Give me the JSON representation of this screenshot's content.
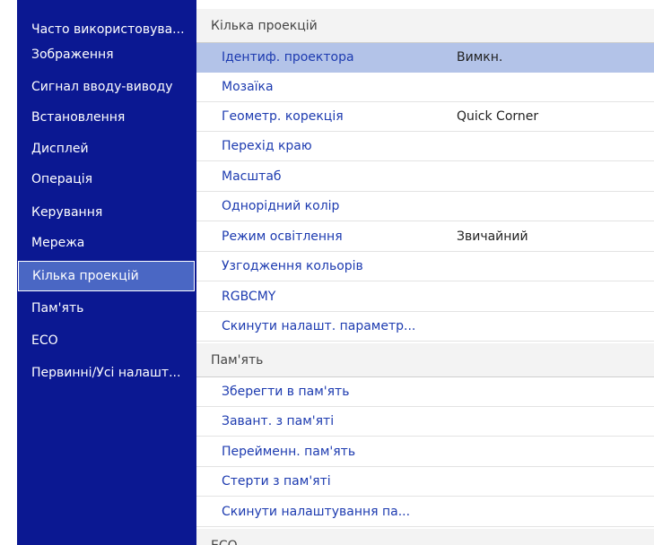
{
  "sidebar": {
    "items": [
      {
        "label": "Часто використовува..."
      },
      {
        "label": "Зображення"
      },
      {
        "label": "Сигнал вводу-виводу"
      },
      {
        "label": "Встановлення"
      },
      {
        "label": "Дисплей"
      },
      {
        "label": "Операція"
      },
      {
        "label": "Керування"
      },
      {
        "label": "Мережа"
      },
      {
        "label": "Кілька проекцій",
        "selected": true
      },
      {
        "label": "Пам'ять"
      },
      {
        "label": "ECO"
      },
      {
        "label": "Первинні/Усі налашт..."
      }
    ]
  },
  "panel": {
    "section_multi": "Кілька проекцій",
    "multi_items": [
      {
        "label": "Ідентиф. проектора",
        "value": "Вимкн."
      },
      {
        "label": "Мозаїка",
        "value": ""
      },
      {
        "label": "Геометр. корекція",
        "value": "Quick Corner"
      },
      {
        "label": "Перехід краю",
        "value": ""
      },
      {
        "label": "Масштаб",
        "value": ""
      },
      {
        "label": "Однорідний колір",
        "value": ""
      },
      {
        "label": "Режим освітлення",
        "value": "Звичайний"
      },
      {
        "label": "Узгодження кольорів",
        "value": ""
      },
      {
        "label": "RGBCMY",
        "value": ""
      },
      {
        "label": "Скинути налашт. параметр...",
        "value": ""
      }
    ],
    "section_memory": "Пам'ять",
    "memory_items": [
      {
        "label": "Зберегти в пам'ять"
      },
      {
        "label": "Завант. з пам'яті"
      },
      {
        "label": "Перейменн. пам'ять"
      },
      {
        "label": "Стерти з пам'яті"
      },
      {
        "label": "Скинути налаштування па..."
      }
    ],
    "section_eco": "ECO"
  },
  "colors": {
    "sidebar_bg": "#0b1892",
    "sidebar_selected": "#4a67c4",
    "row_highlight": "#b3c3e8",
    "item_text": "#1d3bb0"
  }
}
